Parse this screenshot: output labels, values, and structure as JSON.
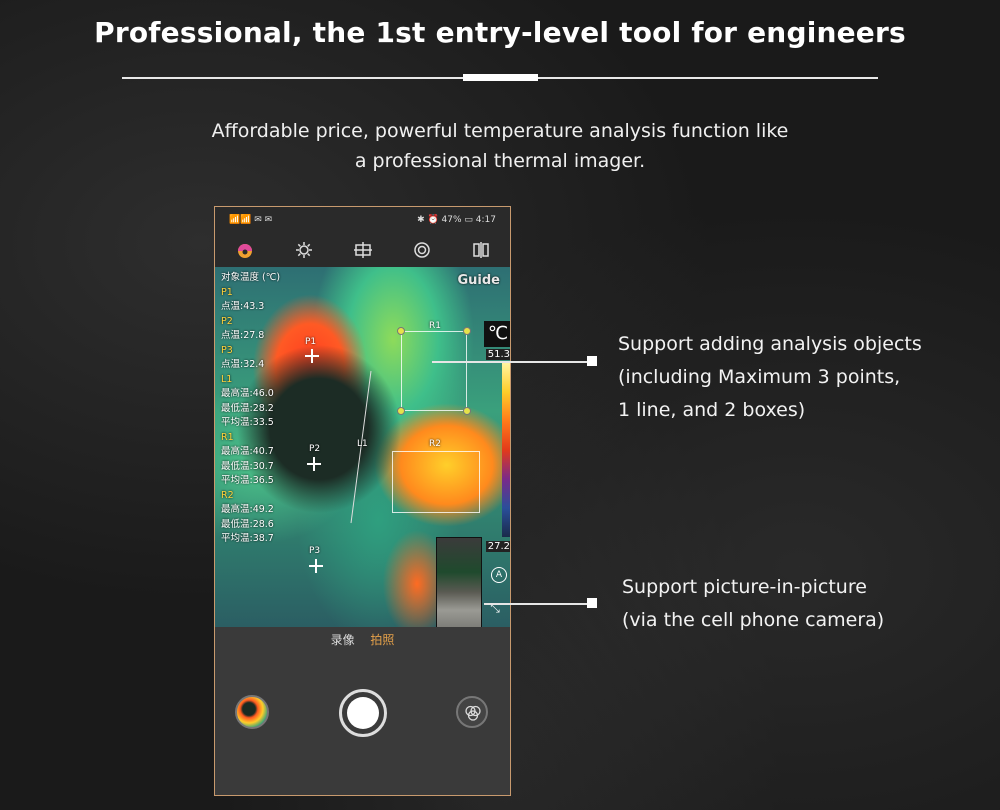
{
  "header": {
    "title": "Professional, the 1st entry-level tool for engineers",
    "subtitle_line1": "Affordable price, powerful temperature analysis function like",
    "subtitle_line2": "a professional thermal imager."
  },
  "phone": {
    "status": {
      "left": "📶📶 ✉ ✉",
      "right": "✱ ⏰ 47% ▭ 4:17"
    },
    "toolbar_icons": [
      "palette-icon",
      "brightness-icon",
      "crosshair-grid-icon",
      "target-icon",
      "compare-icon"
    ],
    "thermal": {
      "brand": "Guide",
      "unit": "℃",
      "max_temp": "51.3",
      "min_temp": "27.2",
      "readout_title": "对象温度 (℃)",
      "readout": [
        {
          "head": "P1",
          "lines": [
            "点温:43.3"
          ]
        },
        {
          "head": "P2",
          "lines": [
            "点温:27.8"
          ]
        },
        {
          "head": "P3",
          "lines": [
            "点温:32.4"
          ]
        },
        {
          "head": "L1",
          "lines": [
            "最高温:46.0",
            "最低温:28.2",
            "平均温:33.5"
          ]
        },
        {
          "head": "R1",
          "lines": [
            "最高温:40.7",
            "最低温:30.7",
            "平均温:36.5"
          ]
        },
        {
          "head": "R2",
          "lines": [
            "最高温:49.2",
            "最低温:28.6",
            "平均温:38.7"
          ]
        }
      ],
      "labels": {
        "p1": "P1",
        "p2": "P2",
        "p3": "P3",
        "l1": "L1",
        "r1": "R1",
        "r2": "R2"
      },
      "pip_badge": "A"
    },
    "modes": {
      "video": "录像",
      "photo": "拍照"
    }
  },
  "callouts": {
    "analysis": [
      "Support adding analysis objects",
      "(including Maximum 3 points,",
      "1 line, and 2 boxes)"
    ],
    "pip": [
      "Support picture-in-picture",
      "(via the cell phone camera)"
    ]
  }
}
